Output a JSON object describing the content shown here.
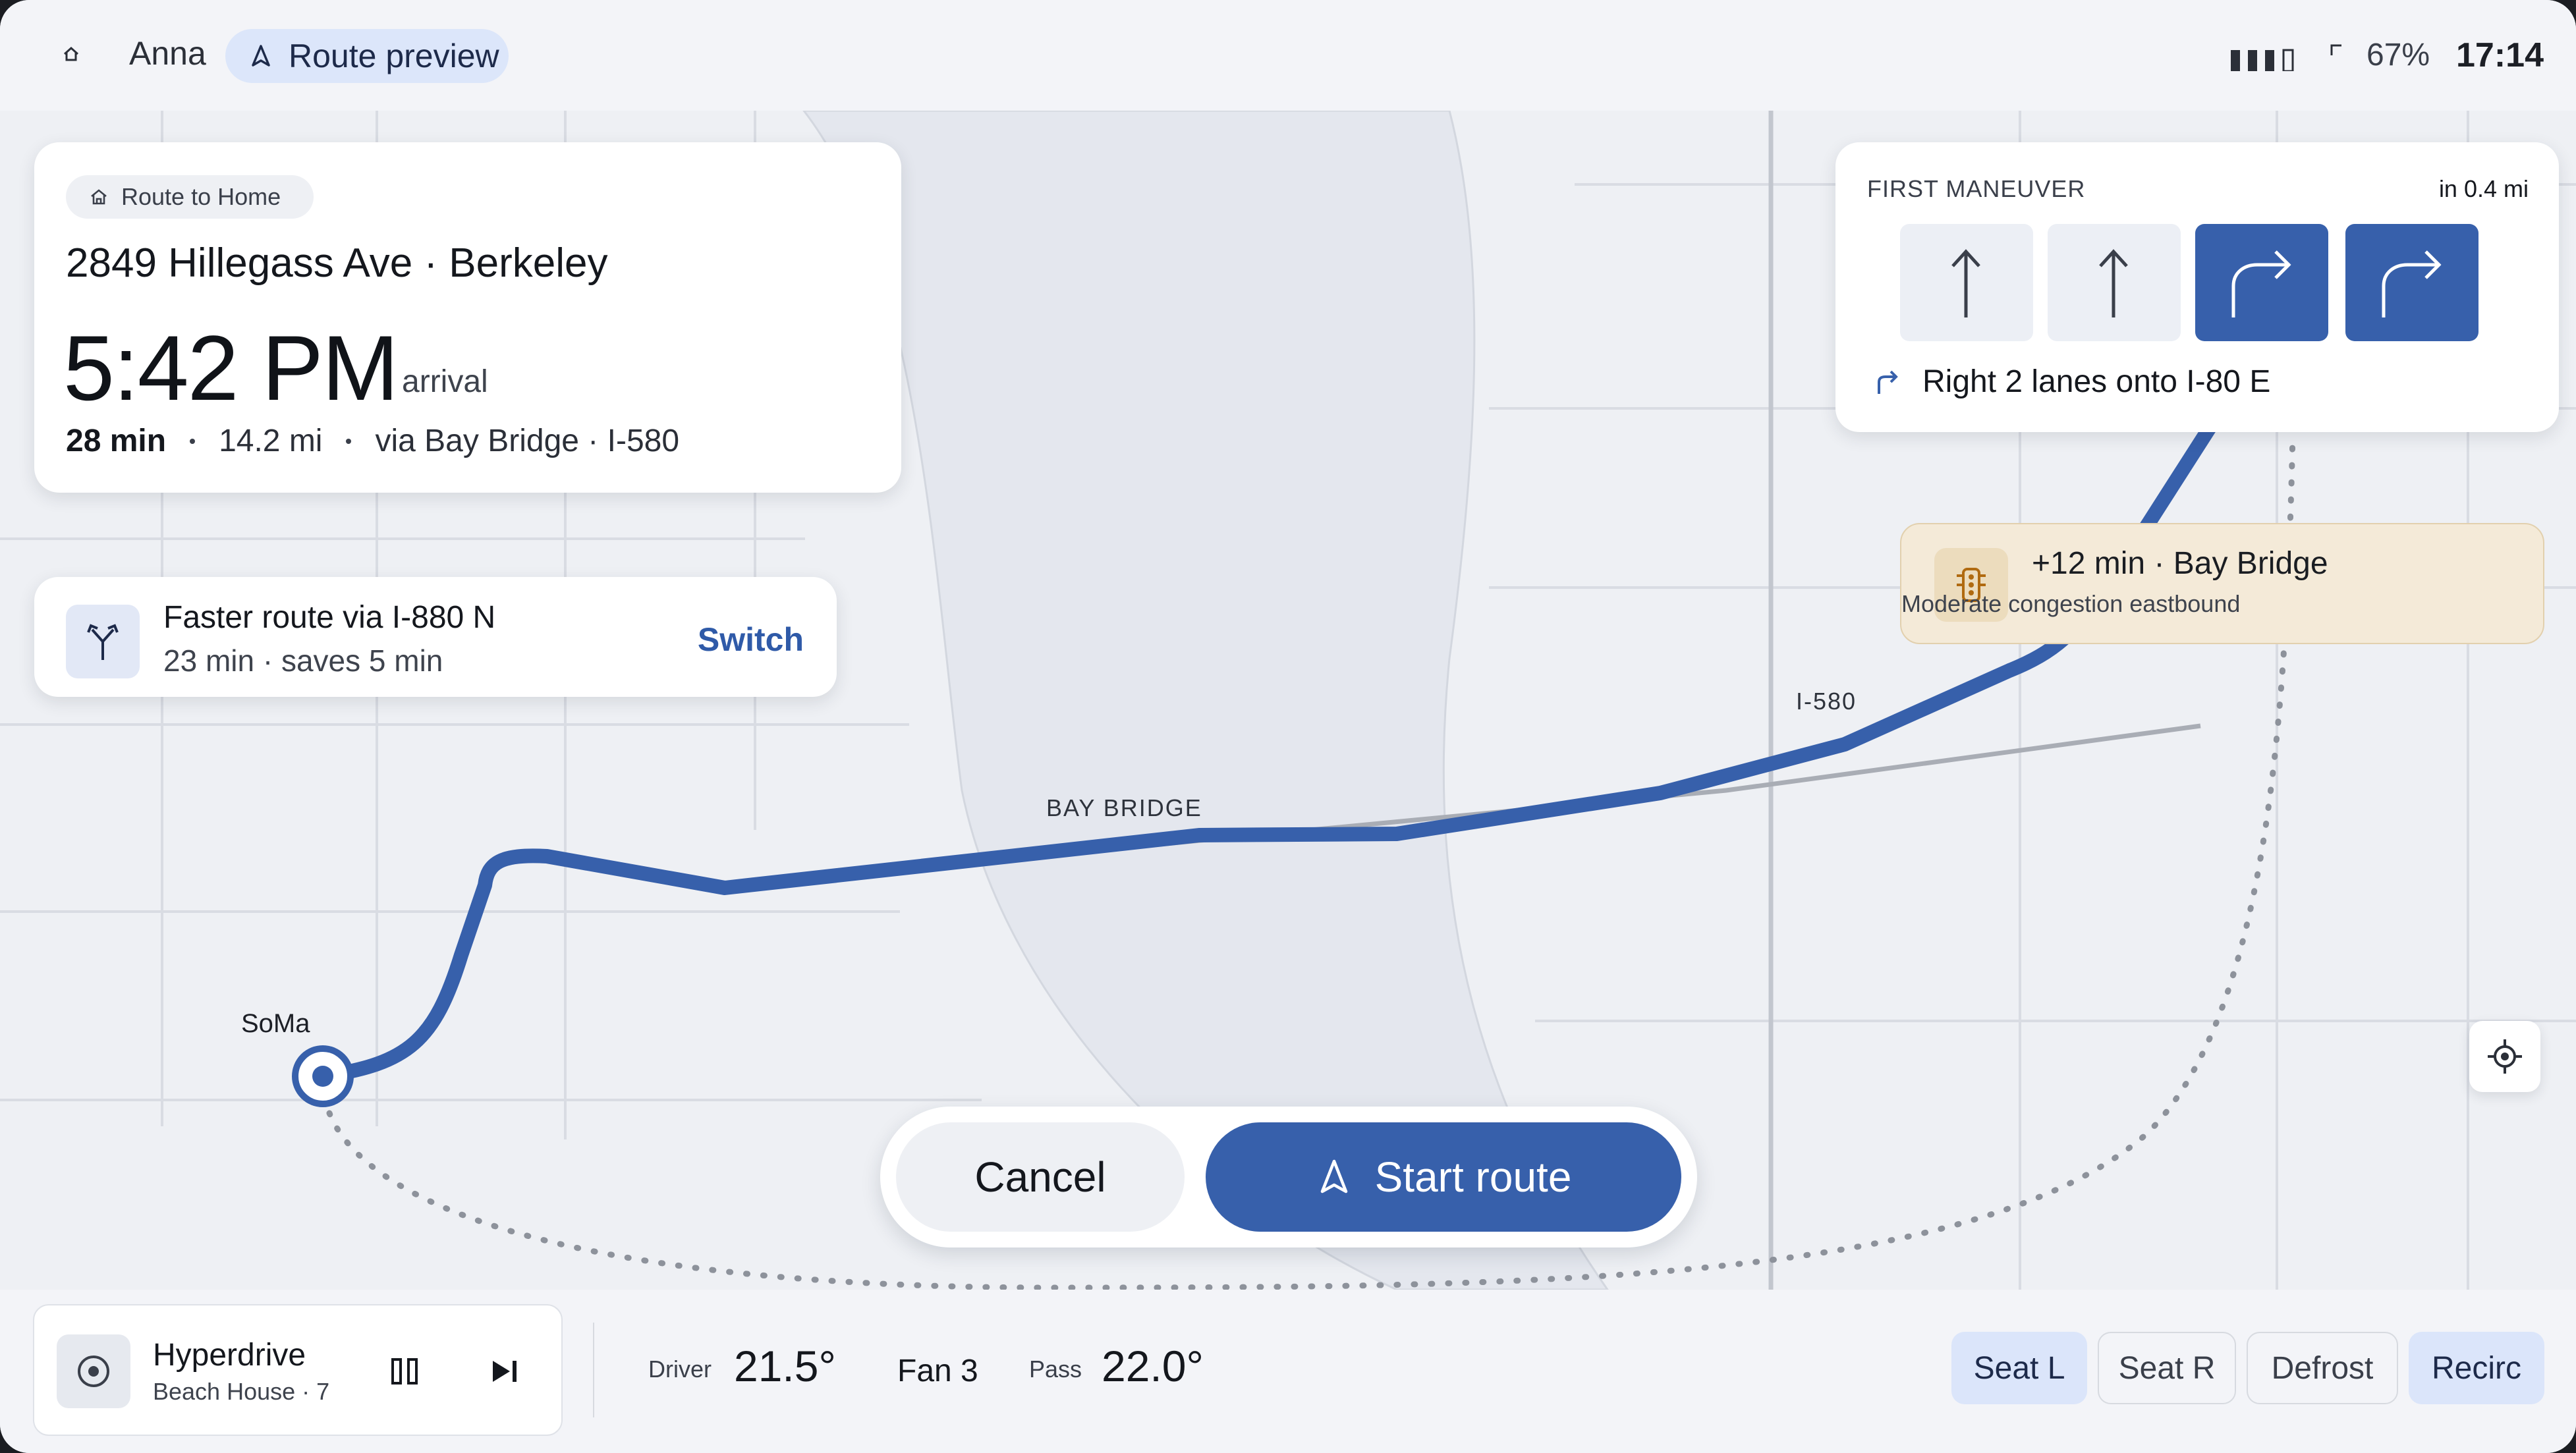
{
  "status_bar": {
    "user": "Anna",
    "mode_chip": "Route preview",
    "battery": "67%",
    "time": "17:14",
    "icons": [
      "home-icon",
      "navigation-arrow-icon",
      "signal-icon",
      "wifi-icon"
    ]
  },
  "destination": {
    "chip_label": "Route to Home",
    "address": "2849 Hillegass Ave · Berkeley",
    "arrival_time": "5:42 PM",
    "arrival_word": "arrival",
    "duration": "28 min",
    "distance": "14.2 mi",
    "via": "via Bay Bridge · I-580"
  },
  "alternative": {
    "title": "Faster route via I-880 N",
    "subtitle": "23 min · saves 5 min",
    "action": "Switch"
  },
  "maneuver": {
    "title": "FIRST MANEUVER",
    "distance": "in 0.4 mi",
    "lanes": [
      {
        "direction": "straight",
        "active": false
      },
      {
        "direction": "straight",
        "active": false
      },
      {
        "direction": "right",
        "active": true
      },
      {
        "direction": "right",
        "active": true
      }
    ],
    "instruction": "Right 2 lanes onto I-80 E"
  },
  "traffic": {
    "title": "+12 min · Bay Bridge",
    "subtitle": "Moderate congestion eastbound"
  },
  "map": {
    "labels": {
      "bay_bridge": "BAY BRIDGE",
      "i580": "I-580",
      "soma": "SoMa"
    },
    "route_color": "#3760ab"
  },
  "actions": {
    "cancel": "Cancel",
    "start": "Start route"
  },
  "media": {
    "track": "Hyperdrive",
    "artist": "Beach House · 7"
  },
  "climate": {
    "driver_label": "Driver",
    "driver_temp": "21.5°",
    "fan": "Fan 3",
    "pass_label": "Pass",
    "pass_temp": "22.0°",
    "buttons": [
      {
        "label": "Seat L",
        "active": true
      },
      {
        "label": "Seat R",
        "active": false
      },
      {
        "label": "Defrost",
        "active": false
      },
      {
        "label": "Recirc",
        "active": true
      }
    ]
  },
  "colors": {
    "accent": "#3760ab",
    "traffic_bg": "#f4ead8",
    "map_bg": "#eceef3"
  }
}
